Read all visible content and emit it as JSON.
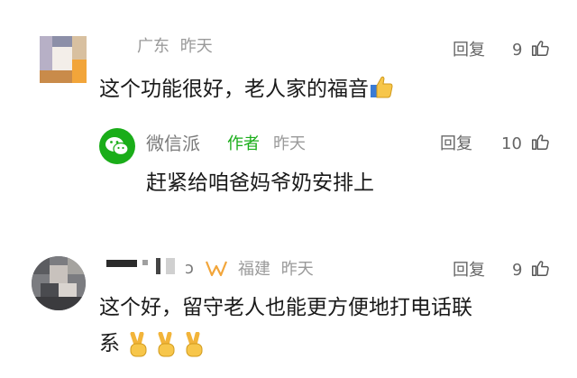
{
  "comments": [
    {
      "region": "广东",
      "time": "昨天",
      "reply_label": "回复",
      "likes": "9",
      "text": "这个功能很好，老人家的福音"
    },
    {
      "name": "微信派",
      "author_badge": "作者",
      "time": "昨天",
      "reply_label": "回复",
      "likes": "10",
      "text": "赶紧给咱爸妈爷奶安排上"
    },
    {
      "region": "福建",
      "time": "昨天",
      "reply_label": "回复",
      "likes": "9",
      "text_line1": "这个好，留守老人也能更方便地打电话联",
      "text_line2": "系"
    }
  ],
  "icons": {
    "like": "thumbs-up-outline-icon",
    "emoji_thumb": "thumbs-up-emoji",
    "emoji_victory": "victory-hand-emoji",
    "wechat": "wechat-logo"
  },
  "colors": {
    "accent_green": "#1aad19",
    "meta_gray": "#9a9a9a"
  }
}
